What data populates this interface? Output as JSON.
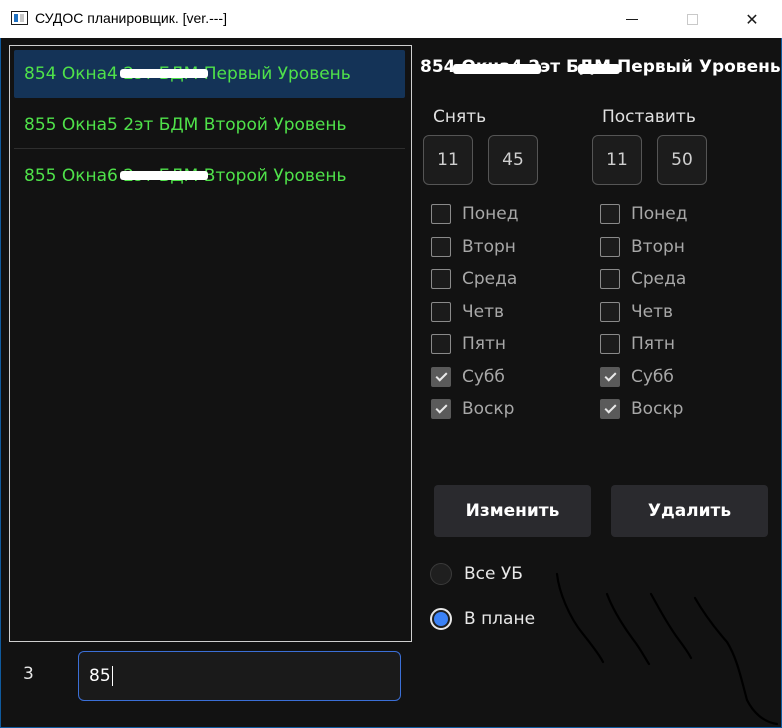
{
  "window": {
    "title": "СУДОС планировщик. [ver.---]",
    "controls": {
      "minimize": "minimize",
      "maximize": "maximize",
      "close": "✕"
    }
  },
  "list": {
    "items": [
      {
        "label": "854 Окна4 2эт БДМ Первый Уровень",
        "selected": true
      },
      {
        "label": "855 Окна5 2эт БДМ Второй Уровень",
        "selected": false
      },
      {
        "label": "855 Окна6 2эт БДМ Второй Уровень",
        "selected": false
      }
    ]
  },
  "bottom": {
    "label": "3",
    "input_value": "85"
  },
  "detail": {
    "title": "854 Окна4 2эт БДМ Первый Уровень",
    "remove": {
      "label": "Снять",
      "hour": "11",
      "minute": "45",
      "days": [
        {
          "label": "Понед",
          "checked": false
        },
        {
          "label": "Вторн",
          "checked": false
        },
        {
          "label": "Среда",
          "checked": false
        },
        {
          "label": "Четв",
          "checked": false
        },
        {
          "label": "Пятн",
          "checked": false
        },
        {
          "label": "Субб",
          "checked": true
        },
        {
          "label": "Воскр",
          "checked": true
        }
      ]
    },
    "set": {
      "label": "Поставить",
      "hour": "11",
      "minute": "50",
      "days": [
        {
          "label": "Понед",
          "checked": false
        },
        {
          "label": "Вторн",
          "checked": false
        },
        {
          "label": "Среда",
          "checked": false
        },
        {
          "label": "Четв",
          "checked": false
        },
        {
          "label": "Пятн",
          "checked": false
        },
        {
          "label": "Субб",
          "checked": true
        },
        {
          "label": "Воскр",
          "checked": true
        }
      ]
    },
    "buttons": {
      "edit": "Изменить",
      "delete": "Удалить"
    },
    "radio": [
      {
        "label": "Все УБ",
        "selected": false
      },
      {
        "label": "В плане",
        "selected": true
      }
    ]
  },
  "colors": {
    "accent": "#3b82f6",
    "list_text": "#4fe24a",
    "selected_bg": "#143357",
    "background": "#121212",
    "frame": "#0f5a9e"
  }
}
